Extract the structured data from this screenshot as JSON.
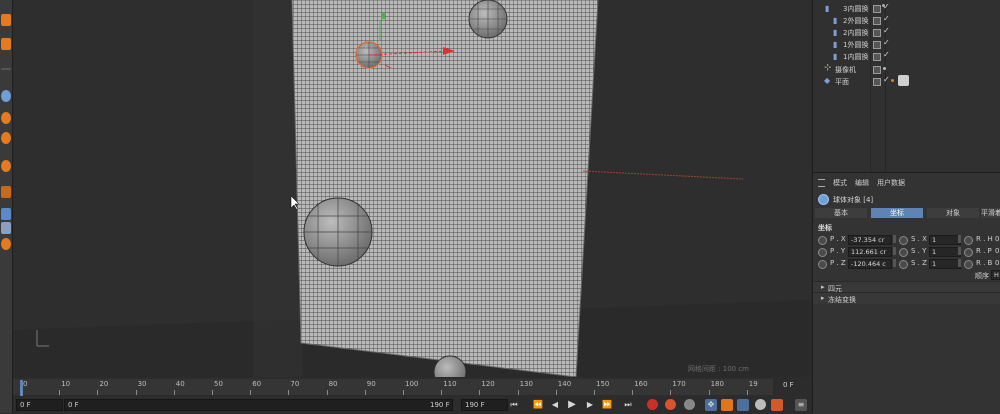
{
  "object_manager": {
    "items": [
      {
        "name": "3内圆换",
        "type": "cloner"
      },
      {
        "name": "2外圆换",
        "type": "cloner"
      },
      {
        "name": "2内圆换",
        "type": "cloner"
      },
      {
        "name": "1外圆换",
        "type": "cloner"
      },
      {
        "name": "1内圆换",
        "type": "cloner"
      },
      {
        "name": "摄像机",
        "type": "camera"
      },
      {
        "name": "平面",
        "type": "plane"
      }
    ]
  },
  "attribute_manager": {
    "menu": [
      "模式",
      "编辑",
      "用户数据"
    ],
    "object_title": "球体对象 [4]",
    "tabs": [
      "基本",
      "坐标",
      "对象",
      "平滑着"
    ],
    "active_tab": "坐标",
    "section_title": "坐标",
    "coords": [
      {
        "pos_label": "P . X",
        "pos_value": "-37.354 cr",
        "scale_label": "S . X",
        "scale_value": "1",
        "rot_label": "R . H",
        "rot_value": "0"
      },
      {
        "pos_label": "P . Y",
        "pos_value": "112.661 cr",
        "scale_label": "S . Y",
        "scale_value": "1",
        "rot_label": "R . P",
        "rot_value": "0"
      },
      {
        "pos_label": "P . Z",
        "pos_value": "-120.464 c",
        "scale_label": "S . Z",
        "scale_value": "1",
        "rot_label": "R . B",
        "rot_value": "0"
      }
    ],
    "order_label": "顺序",
    "order_value": "H",
    "collapsed_sections": [
      "四元",
      "冻结变换"
    ]
  },
  "viewport": {
    "grid_spacing_label": "网格间距 : 100 cm"
  },
  "timeline": {
    "ticks": [
      "0",
      "10",
      "20",
      "30",
      "40",
      "50",
      "60",
      "70",
      "80",
      "90",
      "100",
      "110",
      "120",
      "130",
      "140",
      "150",
      "160",
      "170",
      "180",
      "19"
    ],
    "current_frame_display": "0 F",
    "start_frame": "0 F",
    "min_frame": "0 F",
    "max_frame": "190 F",
    "end_frame": "190 F",
    "colors": {
      "accent": "#5d84b4",
      "record": "#c9302c",
      "key": "#e0751b"
    }
  }
}
